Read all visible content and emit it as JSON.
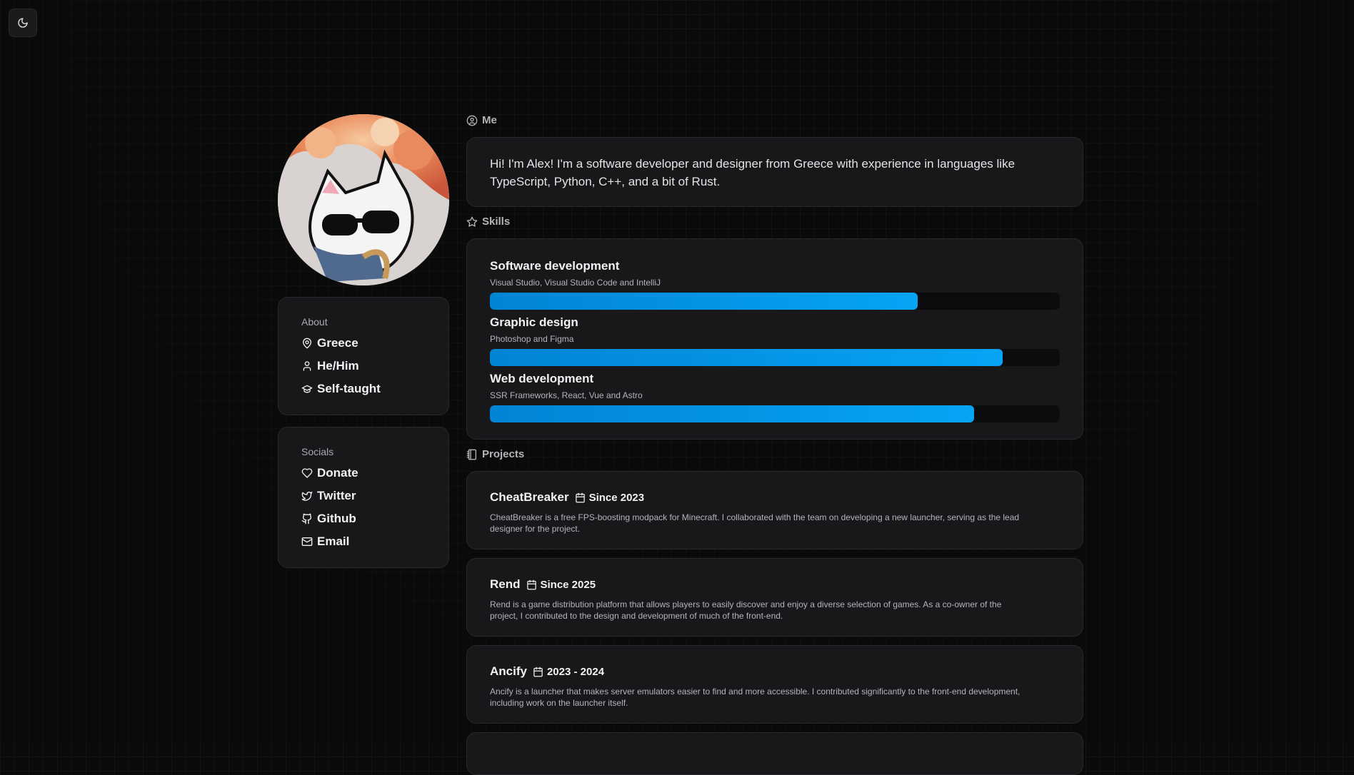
{
  "theme_toggle": {
    "icon": "moon-icon"
  },
  "avatar": {
    "alt": "avatar"
  },
  "about": {
    "title": "About",
    "items": [
      {
        "label": "Greece",
        "icon": "map-pin-icon"
      },
      {
        "label": "He/Him",
        "icon": "user-icon"
      },
      {
        "label": "Self-taught",
        "icon": "graduation-cap-icon"
      }
    ]
  },
  "socials": {
    "title": "Socials",
    "items": [
      {
        "label": "Donate",
        "icon": "heart-icon"
      },
      {
        "label": "Twitter",
        "icon": "twitter-icon"
      },
      {
        "label": "Github",
        "icon": "github-icon"
      },
      {
        "label": "Email",
        "icon": "mail-icon"
      }
    ]
  },
  "me": {
    "label": "Me",
    "text_line1": "Hi! I'm Alex! I'm a software developer and designer from Greece with experience in languages like",
    "text_line2": "TypeScript, Python, C++, and a bit of Rust."
  },
  "skills": {
    "label": "Skills",
    "accent_color": "#0a9ff0",
    "items": [
      {
        "name": "Software development",
        "tools": "Visual Studio, Visual Studio Code and IntelliJ",
        "level": 0.75
      },
      {
        "name": "Graphic design",
        "tools": "Photoshop and Figma",
        "level": 0.9
      },
      {
        "name": "Web development",
        "tools": "SSR Frameworks, React, Vue and Astro",
        "level": 0.85
      }
    ]
  },
  "projects": {
    "label": "Projects",
    "items": [
      {
        "name": "CheatBreaker",
        "date": "Since 2023",
        "desc_line1": "CheatBreaker is a free FPS-boosting modpack for Minecraft. I collaborated with the team on developing a new launcher, serving as the lead",
        "desc_line2": "designer for the project."
      },
      {
        "name": "Rend",
        "date": "Since 2025",
        "desc_line1": "Rend is a game distribution platform that allows players to easily discover and enjoy a diverse selection of games. As a co-owner of the",
        "desc_line2": "project, I contributed to the design and development of much of the front-end."
      },
      {
        "name": "Ancify",
        "date": "2023 - 2024",
        "desc_line1": "Ancify is a launcher that makes server emulators easier to find and more accessible. I contributed significantly to the front-end development,",
        "desc_line2": "including work on the launcher itself."
      }
    ]
  }
}
